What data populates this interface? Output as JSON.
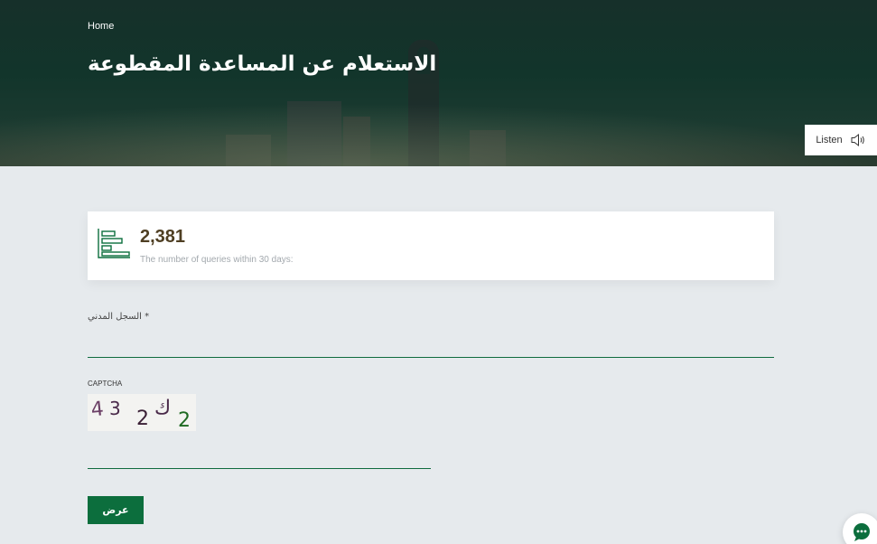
{
  "header": {
    "breadcrumb": "Home",
    "title": "الاستعلام عن المساعدة المقطوعة"
  },
  "listen": {
    "label": "Listen",
    "icon": "speaker-icon"
  },
  "stats": {
    "value": "2,381",
    "label": "The number of queries within 30 days:",
    "icon": "bar-chart-icon"
  },
  "form": {
    "civil_registry_label": "* السجل المدني",
    "civil_registry_value": "",
    "captcha_label": "CAPTCHA",
    "captcha_text": "43 2ك2",
    "captcha_value": "",
    "submit_label": "عرض"
  },
  "chat": {
    "icon": "chat-bubble-icon"
  },
  "colors": {
    "brand_green": "#0c6e3d",
    "hero_dark": "#16302a",
    "stat_value": "#4f3f23",
    "page_bg": "#e6eaed"
  }
}
